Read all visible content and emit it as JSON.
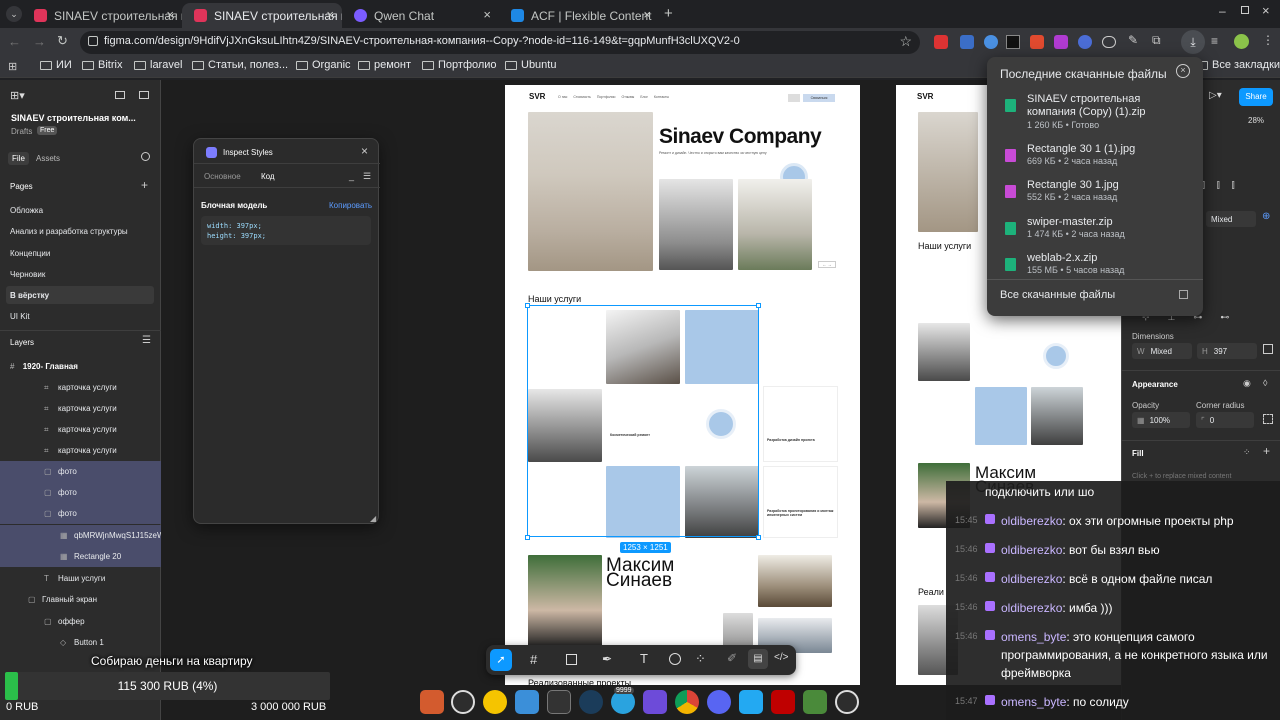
{
  "browser": {
    "tabs": [
      {
        "label": "SINAEV строительная к",
        "active": false
      },
      {
        "label": "SINAEV строительная к",
        "active": true
      },
      {
        "label": "Qwen Chat",
        "active": false
      },
      {
        "label": "ACF | Flexible Content",
        "active": false
      }
    ],
    "url": "figma.com/design/9HdifVjJXnGksuLIhtn4Z9/SINAEV-строительная-компания--Copy-?node-id=116-149&t=gqpMunfH3clUXQV2-0",
    "bookmarks": [
      "ИИ",
      "Bitrix",
      "laravel",
      "Статьи, полез...",
      "Organic",
      "ремонт",
      "Портфолио",
      "Ubuntu"
    ],
    "all_bookmarks": "Все закладки"
  },
  "figma": {
    "file_title": "SINAEV строительная ком...",
    "drafts": "Drafts",
    "plan_badge": "Free",
    "left_tabs": [
      "File",
      "Assets"
    ],
    "pages_header": "Pages",
    "pages": [
      "Обложка",
      "Анализ и разработка структуры",
      "Концепции",
      "Черновик",
      "В вёрстку",
      "UI Kit"
    ],
    "layers_header": "Layers",
    "root_frame": "1920- Главная",
    "layers": [
      {
        "label": "карточка услуги",
        "selected": false
      },
      {
        "label": "карточка услуги",
        "selected": false
      },
      {
        "label": "карточка услуги",
        "selected": false
      },
      {
        "label": "карточка услуги",
        "selected": false
      },
      {
        "label": "фото",
        "selected": true
      },
      {
        "label": "фото",
        "selected": true
      },
      {
        "label": "фото",
        "selected": true
      },
      {
        "label": "qbMRWjnMwqS1J15zeW",
        "selected": true
      },
      {
        "label": "Rectangle 20",
        "selected": true
      },
      {
        "label": "Наши услуги",
        "selected": false
      },
      {
        "label": "Главный экран",
        "selected": false
      },
      {
        "label": "оффер",
        "selected": false
      },
      {
        "label": "Button 1",
        "selected": false
      }
    ],
    "inspect": {
      "title": "Inspect Styles",
      "tabs": [
        "Основное",
        "Код"
      ],
      "section": "Блочная модель",
      "copy": "Копировать",
      "code_lines": [
        "width: 397px;",
        "height: 397px;"
      ]
    },
    "selection_size": "1253 × 1251",
    "right": {
      "share": "Share",
      "zoom": "28%",
      "mixed": "Mixed",
      "dimensions_label": "Dimensions",
      "w_label": "W",
      "w_value": "Mixed",
      "h_label": "H",
      "h_value": "397",
      "appearance": "Appearance",
      "opacity_label": "Opacity",
      "opacity_value": "100%",
      "radius_label": "Corner radius",
      "radius_value": "0",
      "fill": "Fill",
      "fill_hint": "Click + to replace mixed content"
    }
  },
  "mockup": {
    "logo": "SVR",
    "company": "Sinaev Company",
    "tagline": "Ремонт и дизайн. Честно и открыто вам качество за честную цену",
    "nav": [
      "О нас",
      "Стоимость",
      "Портфолио",
      "Отзывы",
      "Блог",
      "Контакты"
    ],
    "cta": "Связаться",
    "services_title": "Наши услуги",
    "cards": [
      "Косметический ремонт",
      "Разработка дизайн проекта",
      "Разработка проектирования и монтаж инженерных систем"
    ],
    "person_first": "Максим",
    "person_last": "Синаев",
    "realized": "Реализованные проекты",
    "realized_short": "Реали"
  },
  "downloads": {
    "title": "Последние скачанные файлы",
    "items": [
      {
        "name": "SINAEV строительная компания (Copy) (1).zip",
        "meta": "1 260 КБ • Готово"
      },
      {
        "name": "Rectangle 30 1 (1).jpg",
        "meta": "669 КБ • 2 часа назад"
      },
      {
        "name": "Rectangle 30 1.jpg",
        "meta": "552 КБ • 2 часа назад"
      },
      {
        "name": "swiper-master.zip",
        "meta": "1 474 КБ • 2 часа назад"
      },
      {
        "name": "weblab-2.x.zip",
        "meta": "155 МБ • 5 часов назад"
      }
    ],
    "all": "Все скачанные файлы"
  },
  "chat": {
    "top_fragment": "подключить или шо",
    "messages": [
      {
        "time": "15:45",
        "user": "oldiberezko",
        "text": "ох эти огромные проекты php"
      },
      {
        "time": "15:46",
        "user": "oldiberezko",
        "text": "вот бы взял вью"
      },
      {
        "time": "15:46",
        "user": "oldiberezko",
        "text": "всё в одном файле писал"
      },
      {
        "time": "15:46",
        "user": "oldiberezko",
        "text": "имба )))"
      },
      {
        "time": "15:46",
        "user": "omens_byte",
        "text": "это концепция самого программирования, а не конкретного языка или фреймворка"
      },
      {
        "time": "15:47",
        "user": "omens_byte",
        "text": "по солиду"
      }
    ]
  },
  "donation": {
    "title": "Собираю деньги на квартиру",
    "progress_text": "115 300 RUB (4%)",
    "progress_fraction": 0.04,
    "min": "0 RUB",
    "max": "3 000 000 RUB"
  },
  "taskbar": {
    "badge": "9999"
  }
}
